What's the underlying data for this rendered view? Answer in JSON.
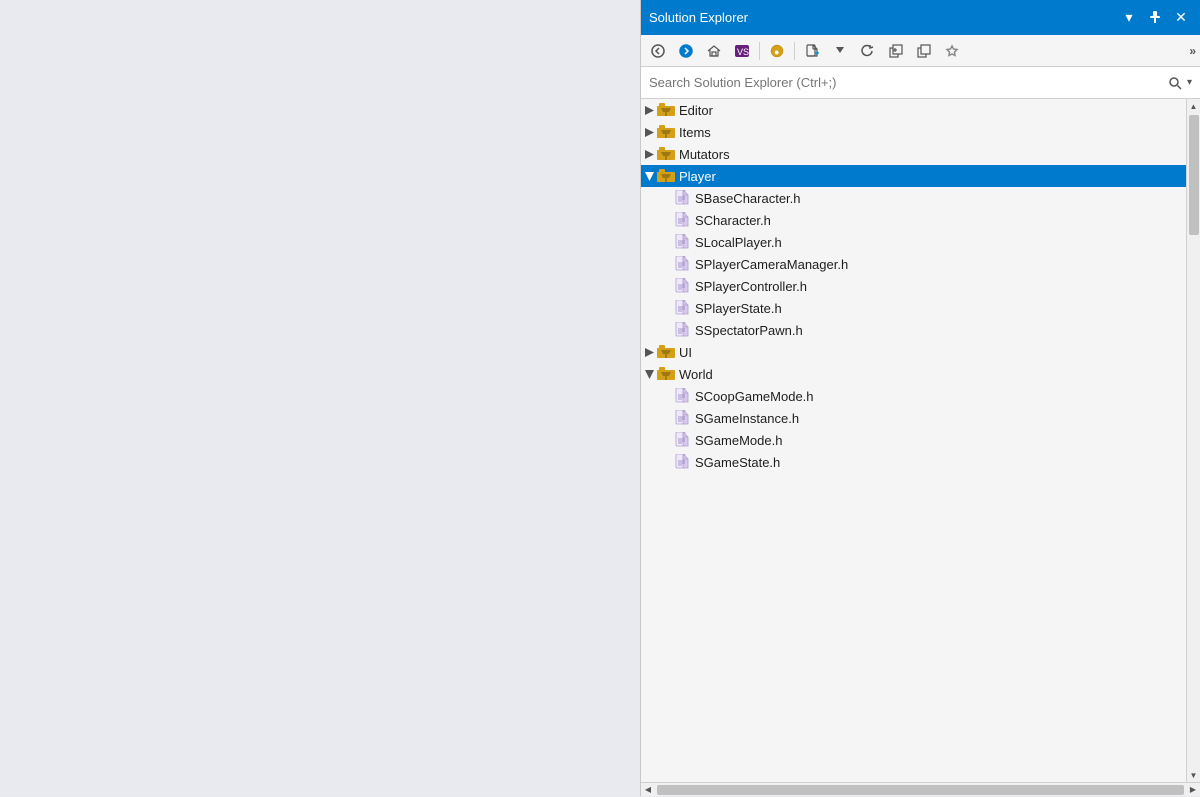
{
  "title_bar": {
    "title": "Solution Explorer",
    "pin_label": "📌",
    "close_label": "✕",
    "dropdown_label": "▼"
  },
  "toolbar": {
    "back_tooltip": "Back",
    "forward_tooltip": "Forward",
    "home_tooltip": "Home",
    "vs_tooltip": "Visual Studio",
    "filter_tooltip": "Filter",
    "new_file_tooltip": "New File",
    "refresh_tooltip": "Refresh",
    "collapse_tooltip": "Collapse All",
    "copy_tooltip": "Copy",
    "properties_tooltip": "Properties",
    "more_label": "»"
  },
  "search": {
    "placeholder": "Search Solution Explorer (Ctrl+;)"
  },
  "tree": {
    "items": [
      {
        "id": "editor",
        "label": "Editor",
        "type": "folder",
        "level": 1,
        "expanded": false,
        "selected": false
      },
      {
        "id": "items",
        "label": "Items",
        "type": "folder",
        "level": 1,
        "expanded": false,
        "selected": false
      },
      {
        "id": "mutators",
        "label": "Mutators",
        "type": "folder",
        "level": 1,
        "expanded": false,
        "selected": false
      },
      {
        "id": "player",
        "label": "Player",
        "type": "folder",
        "level": 1,
        "expanded": true,
        "selected": true
      },
      {
        "id": "sbasechar",
        "label": "SBaseCharacter.h",
        "type": "file",
        "level": 2,
        "expanded": false,
        "selected": false
      },
      {
        "id": "schar",
        "label": "SCharacter.h",
        "type": "file",
        "level": 2,
        "expanded": false,
        "selected": false
      },
      {
        "id": "slocalplayer",
        "label": "SLocalPlayer.h",
        "type": "file",
        "level": 2,
        "expanded": false,
        "selected": false
      },
      {
        "id": "scameramanager",
        "label": "SPlayerCameraManager.h",
        "type": "file",
        "level": 2,
        "expanded": false,
        "selected": false
      },
      {
        "id": "scontroller",
        "label": "SPlayerController.h",
        "type": "file",
        "level": 2,
        "expanded": false,
        "selected": false
      },
      {
        "id": "sstate",
        "label": "SPlayerState.h",
        "type": "file",
        "level": 2,
        "expanded": false,
        "selected": false
      },
      {
        "id": "sspectator",
        "label": "SSpectatorPawn.h",
        "type": "file",
        "level": 2,
        "expanded": false,
        "selected": false
      },
      {
        "id": "ui",
        "label": "UI",
        "type": "folder",
        "level": 1,
        "expanded": false,
        "selected": false
      },
      {
        "id": "world",
        "label": "World",
        "type": "folder",
        "level": 1,
        "expanded": true,
        "selected": false
      },
      {
        "id": "scoop",
        "label": "SCoopGameMode.h",
        "type": "file",
        "level": 2,
        "expanded": false,
        "selected": false
      },
      {
        "id": "sgameinstance",
        "label": "SGameInstance.h",
        "type": "file",
        "level": 2,
        "expanded": false,
        "selected": false
      },
      {
        "id": "sgamemode",
        "label": "SGameMode.h",
        "type": "file",
        "level": 2,
        "expanded": false,
        "selected": false
      },
      {
        "id": "sgamestate",
        "label": "SGameState.h",
        "type": "file",
        "level": 2,
        "expanded": false,
        "selected": false
      }
    ]
  },
  "colors": {
    "titlebar_bg": "#007acc",
    "selected_bg": "#007acc",
    "panel_bg": "#f5f5f5"
  }
}
